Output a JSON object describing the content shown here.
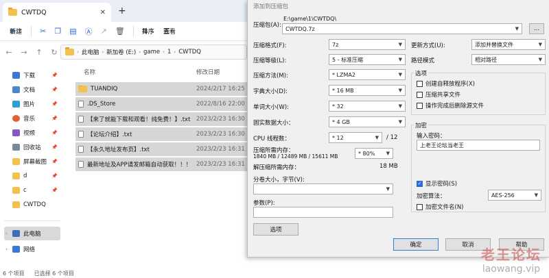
{
  "explorer": {
    "tab_title": "CWTDQ",
    "tab_close": "✕",
    "tab_add": "+",
    "commands": {
      "new_label": "新建",
      "sort_label": "排序",
      "view_label": "查看"
    },
    "breadcrumbs": [
      "此电脑",
      "新加卷 (E:)",
      "game",
      "1",
      "CWTDQ"
    ],
    "sidebar": {
      "items": [
        {
          "label": "下载",
          "color": "#3a78d8",
          "pinned": true
        },
        {
          "label": "文档",
          "color": "#4f86c6",
          "pinned": true
        },
        {
          "label": "图片",
          "color": "#2f9fd6",
          "pinned": true
        },
        {
          "label": "音乐",
          "color": "#e0623a",
          "pinned": true
        },
        {
          "label": "视频",
          "color": "#8a55c9",
          "pinned": true
        },
        {
          "label": "回收站",
          "color": "#7a8a9a",
          "pinned": true
        },
        {
          "label": "屏幕截图",
          "color": "#f2c14e",
          "pinned": true
        },
        {
          "label": "d",
          "color": "#f2c14e",
          "pinned": true
        },
        {
          "label": "c",
          "color": "#f2c14e",
          "pinned": true
        },
        {
          "label": "CWTDQ",
          "color": "#f2c14e",
          "pinned": false
        }
      ],
      "this_pc": "此电脑",
      "network": "网络"
    },
    "columns": {
      "name": "名称",
      "modified": "修改日期"
    },
    "files": [
      {
        "name": "TUANDIQ",
        "date": "2024/2/17 16:25",
        "type": "folder"
      },
      {
        "name": ".DS_Store",
        "date": "2022/8/16 22:00",
        "type": "file"
      },
      {
        "name": "【来了就能下载和观看！纯免费！】.txt",
        "date": "2023/2/23 16:30",
        "type": "file"
      },
      {
        "name": "【论坛介绍】.txt",
        "date": "2023/2/23 16:30",
        "type": "file"
      },
      {
        "name": "【永久地址发布页】.txt",
        "date": "2023/2/23 16:31",
        "type": "file"
      },
      {
        "name": "最新地址及APP请发邮箱自动获取！！！",
        "date": "2023/2/23 16:31",
        "type": "file"
      }
    ],
    "status": {
      "count": "6 个项目",
      "selected": "已选择 6 个项目"
    }
  },
  "dialog": {
    "title": "添加到压缩包",
    "archive_label": "压缩包(A):",
    "archive_path": "E:\\game\\1\\CWTDQ\\",
    "archive_name": "CWTDQ.7z",
    "browse_label": "...",
    "format_label": "压缩格式(F):",
    "format_value": "7z",
    "level_label": "压缩等级(L):",
    "level_value": "5 - 标准压缩",
    "method_label": "压缩方法(M):",
    "method_value": "* LZMA2",
    "dict_label": "字典大小(D):",
    "dict_value": "* 16 MB",
    "word_label": "单词大小(W):",
    "word_value": "* 32",
    "solid_label": "固实数据大小：",
    "solid_value": "* 4 GB",
    "threads_label": "CPU 线程数：",
    "threads_value": "* 12",
    "threads_total": "/ 12",
    "mem_label": "压缩所需内存：",
    "mem_values": "1840 MB / 12489 MB / 15611 MB",
    "mem_percent": "* 80%",
    "decomp_label": "解压缩所需内存：",
    "decomp_value": "18 MB",
    "split_label": "分卷大小，字节(V):",
    "params_label": "参数(P):",
    "options_button": "选项",
    "update_label": "更新方式(U):",
    "update_value": "添加并替换文件",
    "path_label": "路径模式",
    "path_value": "相对路径",
    "options_group": "选项",
    "opt_sfx": "创建自释放程序(X)",
    "opt_shared": "压缩共享文件",
    "opt_delete": "操作完成后删除源文件",
    "encrypt_group": "加密",
    "pwd_label": "输入密码：",
    "pwd_value": "上老王论坛当老王",
    "show_pwd": "显示密码(S)",
    "enc_method_label": "加密算法：",
    "enc_method_value": "AES-256",
    "enc_names": "加密文件名(N)",
    "ok": "确定",
    "cancel": "取消",
    "help": "帮助"
  },
  "watermark": {
    "line1": "老王论坛",
    "line2": "laowang.vip"
  }
}
